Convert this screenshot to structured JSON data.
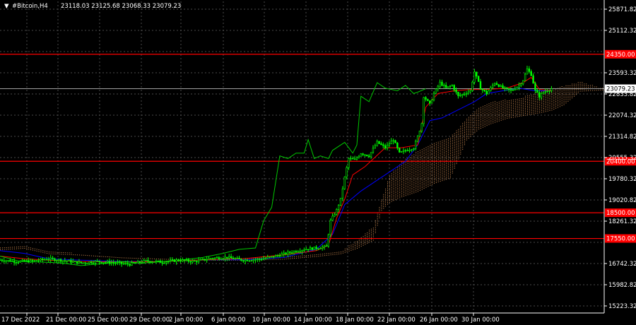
{
  "header": {
    "arrow": "▼",
    "symbol": "#Bitcoin,H4",
    "ohlc": "23118.03 23125.68 23068.33 23079.23"
  },
  "colors": {
    "background": "#000000",
    "grid": "#4a4a4a",
    "axis": "#ffffff",
    "candle": "#00ff00",
    "level": "#ff0000",
    "tenkan": "#ff0000",
    "kijun": "#0000ff",
    "chikou": "#00c800",
    "kumo": "#f4a460",
    "price_line": "#a0a0a0"
  },
  "chart_data": {
    "type": "candlestick",
    "symbol": "#Bitcoin",
    "timeframe": "H4",
    "ylim": [
      14800,
      26300
    ],
    "y_ticks": [
      25871.82,
      25112.32,
      24352.82,
      23593.32,
      22833.82,
      22074.32,
      21314.82,
      20555.32,
      19795.82,
      19036.32,
      18276.82,
      17517.32,
      16757.82,
      15998.32,
      15238.82
    ],
    "y_tick_labels": [
      "25871.82",
      "25112.32",
      "23593.32",
      "22833.82",
      "22074.32",
      "21314.82",
      "20555.32",
      "19780.32",
      "19020.82",
      "18261.32",
      "16742.32",
      "15982.82",
      "15223.32"
    ],
    "x_tick_labels": [
      "17 Dec 2022",
      "21 Dec 00:00",
      "25 Dec 00:00",
      "29 Dec 00:00",
      "2 Jan 00:00",
      "6 Jan 00:00",
      "10 Jan 00:00",
      "14 Jan 00:00",
      "18 Jan 00:00",
      "22 Jan 00:00",
      "26 Jan 00:00",
      "30 Jan 00:00"
    ],
    "current_price": 23079.23,
    "current_price_label": "23079.23",
    "levels": [
      {
        "value": 24350.0,
        "label": "24350.00"
      },
      {
        "value": 20400.0,
        "label": "20400.00"
      },
      {
        "value": 18500.0,
        "label": "18500.00"
      },
      {
        "value": 17550.0,
        "label": "17550.00"
      }
    ],
    "close_path": [
      [
        0,
        16760
      ],
      [
        8,
        16700
      ],
      [
        16,
        16720
      ],
      [
        24,
        16800
      ],
      [
        32,
        16730
      ],
      [
        40,
        16650
      ],
      [
        48,
        16700
      ],
      [
        56,
        16650
      ],
      [
        64,
        16600
      ],
      [
        72,
        16720
      ],
      [
        80,
        16680
      ],
      [
        88,
        16750
      ],
      [
        96,
        16700
      ],
      [
        104,
        16820
      ],
      [
        112,
        16850
      ],
      [
        120,
        16750
      ],
      [
        128,
        16780
      ],
      [
        136,
        16900
      ],
      [
        144,
        17050
      ],
      [
        150,
        17150
      ],
      [
        156,
        17200
      ],
      [
        161,
        17250
      ],
      [
        163,
        18200
      ],
      [
        166,
        18600
      ],
      [
        168,
        19000
      ],
      [
        170,
        19800
      ],
      [
        172,
        20500
      ],
      [
        175,
        20450
      ],
      [
        178,
        20700
      ],
      [
        182,
        20600
      ],
      [
        186,
        21100
      ],
      [
        190,
        20900
      ],
      [
        194,
        21200
      ],
      [
        197,
        20700
      ],
      [
        200,
        20800
      ],
      [
        204,
        20900
      ],
      [
        206,
        21300
      ],
      [
        208,
        21800
      ],
      [
        209,
        22800
      ],
      [
        212,
        22500
      ],
      [
        214,
        22900
      ],
      [
        217,
        23300
      ],
      [
        220,
        23100
      ],
      [
        223,
        23200
      ],
      [
        226,
        22800
      ],
      [
        229,
        22900
      ],
      [
        232,
        23000
      ],
      [
        234,
        23700
      ],
      [
        237,
        23100
      ],
      [
        240,
        22900
      ],
      [
        244,
        23300
      ],
      [
        248,
        23100
      ],
      [
        252,
        23000
      ],
      [
        256,
        23200
      ],
      [
        258,
        23400
      ],
      [
        260,
        23800
      ],
      [
        262,
        23600
      ],
      [
        264,
        23000
      ],
      [
        266,
        22800
      ],
      [
        268,
        22950
      ],
      [
        272,
        23079.23
      ]
    ],
    "tenkan_path": [
      [
        0,
        16900
      ],
      [
        12,
        16800
      ],
      [
        24,
        16750
      ],
      [
        40,
        16700
      ],
      [
        60,
        16680
      ],
      [
        80,
        16700
      ],
      [
        100,
        16760
      ],
      [
        120,
        16800
      ],
      [
        140,
        16950
      ],
      [
        156,
        17100
      ],
      [
        162,
        17300
      ],
      [
        166,
        18300
      ],
      [
        170,
        19000
      ],
      [
        174,
        19900
      ],
      [
        180,
        20200
      ],
      [
        190,
        20900
      ],
      [
        198,
        20900
      ],
      [
        206,
        21000
      ],
      [
        210,
        22400
      ],
      [
        216,
        22900
      ],
      [
        224,
        23000
      ],
      [
        232,
        23050
      ],
      [
        240,
        23050
      ],
      [
        250,
        23100
      ],
      [
        258,
        23300
      ],
      [
        262,
        23500
      ],
      [
        266,
        23050
      ],
      [
        272,
        23000
      ]
    ],
    "kijun_path": [
      [
        0,
        17100
      ],
      [
        12,
        17000
      ],
      [
        24,
        16800
      ],
      [
        40,
        16750
      ],
      [
        60,
        16700
      ],
      [
        80,
        16700
      ],
      [
        100,
        16760
      ],
      [
        120,
        16760
      ],
      [
        140,
        16850
      ],
      [
        156,
        17150
      ],
      [
        164,
        17700
      ],
      [
        170,
        18800
      ],
      [
        178,
        19300
      ],
      [
        186,
        19700
      ],
      [
        194,
        20100
      ],
      [
        200,
        20400
      ],
      [
        206,
        21000
      ],
      [
        212,
        21900
      ],
      [
        218,
        22000
      ],
      [
        226,
        22300
      ],
      [
        234,
        22600
      ],
      [
        240,
        22900
      ],
      [
        248,
        23000
      ],
      [
        256,
        23100
      ],
      [
        264,
        23000
      ],
      [
        272,
        23000
      ]
    ],
    "chikou_path": [
      [
        0,
        16900
      ],
      [
        10,
        16700
      ],
      [
        20,
        16680
      ],
      [
        30,
        16650
      ],
      [
        40,
        16550
      ],
      [
        50,
        16620
      ],
      [
        60,
        16700
      ],
      [
        70,
        16640
      ],
      [
        80,
        16700
      ],
      [
        90,
        16760
      ],
      [
        100,
        16850
      ],
      [
        110,
        17000
      ],
      [
        118,
        17150
      ],
      [
        126,
        17200
      ],
      [
        130,
        18200
      ],
      [
        134,
        18700
      ],
      [
        138,
        20600
      ],
      [
        142,
        20500
      ],
      [
        146,
        20700
      ],
      [
        150,
        20700
      ],
      [
        152,
        21200
      ],
      [
        155,
        20500
      ],
      [
        158,
        20600
      ],
      [
        162,
        20500
      ],
      [
        164,
        20800
      ],
      [
        170,
        21100
      ],
      [
        174,
        20700
      ],
      [
        176,
        21000
      ],
      [
        178,
        22800
      ],
      [
        182,
        22600
      ],
      [
        186,
        23300
      ],
      [
        190,
        23100
      ],
      [
        196,
        23000
      ],
      [
        200,
        23200
      ],
      [
        204,
        22900
      ],
      [
        206,
        22950
      ],
      [
        210,
        23079.23
      ]
    ],
    "kumo": {
      "span_a": [
        [
          0,
          17250
        ],
        [
          12,
          17300
        ],
        [
          24,
          17100
        ],
        [
          40,
          17000
        ],
        [
          60,
          16900
        ],
        [
          80,
          16850
        ],
        [
          100,
          16800
        ],
        [
          120,
          16850
        ],
        [
          140,
          16900
        ],
        [
          156,
          17000
        ],
        [
          168,
          17100
        ],
        [
          176,
          17500
        ],
        [
          184,
          18000
        ],
        [
          188,
          19000
        ],
        [
          192,
          19900
        ],
        [
          198,
          20400
        ],
        [
          206,
          20800
        ],
        [
          214,
          21100
        ],
        [
          222,
          21300
        ],
        [
          230,
          22000
        ],
        [
          236,
          22400
        ],
        [
          242,
          22600
        ],
        [
          250,
          22700
        ],
        [
          258,
          22800
        ],
        [
          266,
          23000
        ],
        [
          272,
          23100
        ],
        [
          278,
          23200
        ],
        [
          286,
          23350
        ],
        [
          298,
          23100
        ]
      ],
      "span_b": [
        [
          0,
          17150
        ],
        [
          12,
          17200
        ],
        [
          24,
          17000
        ],
        [
          40,
          16950
        ],
        [
          60,
          16850
        ],
        [
          80,
          16800
        ],
        [
          100,
          16760
        ],
        [
          120,
          16760
        ],
        [
          140,
          16800
        ],
        [
          156,
          16900
        ],
        [
          168,
          17000
        ],
        [
          176,
          17200
        ],
        [
          184,
          17500
        ],
        [
          188,
          18600
        ],
        [
          192,
          18900
        ],
        [
          198,
          19100
        ],
        [
          206,
          19300
        ],
        [
          214,
          19600
        ],
        [
          222,
          19800
        ],
        [
          230,
          21200
        ],
        [
          236,
          21600
        ],
        [
          242,
          21800
        ],
        [
          250,
          22000
        ],
        [
          258,
          22100
        ],
        [
          266,
          22200
        ],
        [
          272,
          22300
        ],
        [
          278,
          22500
        ],
        [
          286,
          23000
        ],
        [
          298,
          23050
        ]
      ]
    }
  }
}
